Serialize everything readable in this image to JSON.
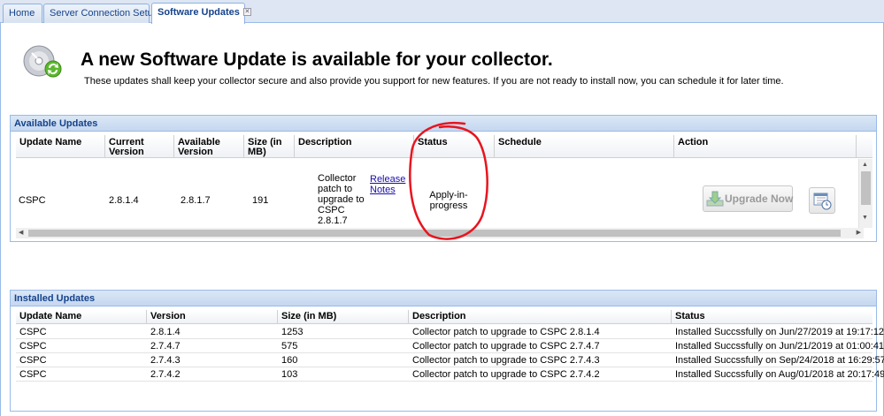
{
  "tabs": [
    {
      "label": "Home"
    },
    {
      "label": "Server Connection Setup",
      "closable": true
    },
    {
      "label": "Software Updates",
      "closable": true,
      "active": true
    }
  ],
  "header": {
    "title": "A new Software Update is available for your collector.",
    "subtitle": "These updates shall keep your collector secure and also provide you support for new features. If you are not ready to install now, you can schedule it for later time."
  },
  "available": {
    "title": "Available Updates",
    "columns": [
      "Update Name",
      "Current Version",
      "Available Version",
      "Size (in MB)",
      "Description",
      "Status",
      "Schedule",
      "Action"
    ],
    "row": {
      "name": "CSPC",
      "current_version": "2.8.1.4",
      "available_version": "2.8.1.7",
      "size": "191",
      "description": "Collector patch to upgrade to CSPC 2.8.1.7",
      "release_notes": "Release Notes",
      "status": "Apply-in-progress",
      "upgrade_label": "Upgrade Now"
    }
  },
  "installed": {
    "title": "Installed Updates",
    "columns": [
      "Update Name",
      "Version",
      "Size (in MB)",
      "Description",
      "Status"
    ],
    "rows": [
      {
        "name": "CSPC",
        "version": "2.8.1.4",
        "size": "1253",
        "description": "Collector patch to upgrade to CSPC 2.8.1.4",
        "status": "Installed Succssfully on Jun/27/2019 at 19:17:12"
      },
      {
        "name": "CSPC",
        "version": "2.7.4.7",
        "size": "575",
        "description": "Collector patch to upgrade to CSPC 2.7.4.7",
        "status": "Installed Succssfully on Jun/21/2019 at 01:00:41"
      },
      {
        "name": "CSPC",
        "version": "2.7.4.3",
        "size": "160",
        "description": "Collector patch to upgrade to CSPC 2.7.4.3",
        "status": "Installed Succssfully on Sep/24/2018 at 16:29:57"
      },
      {
        "name": "CSPC",
        "version": "2.7.4.2",
        "size": "103",
        "description": "Collector patch to upgrade to CSPC 2.7.4.2",
        "status": "Installed Succssfully on Aug/01/2018 at 20:17:49"
      }
    ]
  },
  "colors": {
    "accent": "#15428b",
    "annotation": "#e8141e"
  },
  "icons": [
    "software-update-icon",
    "close-icon",
    "download-icon",
    "calendar-icon",
    "scroll-up-icon",
    "scroll-down-icon",
    "scroll-left-icon",
    "scroll-right-icon"
  ]
}
